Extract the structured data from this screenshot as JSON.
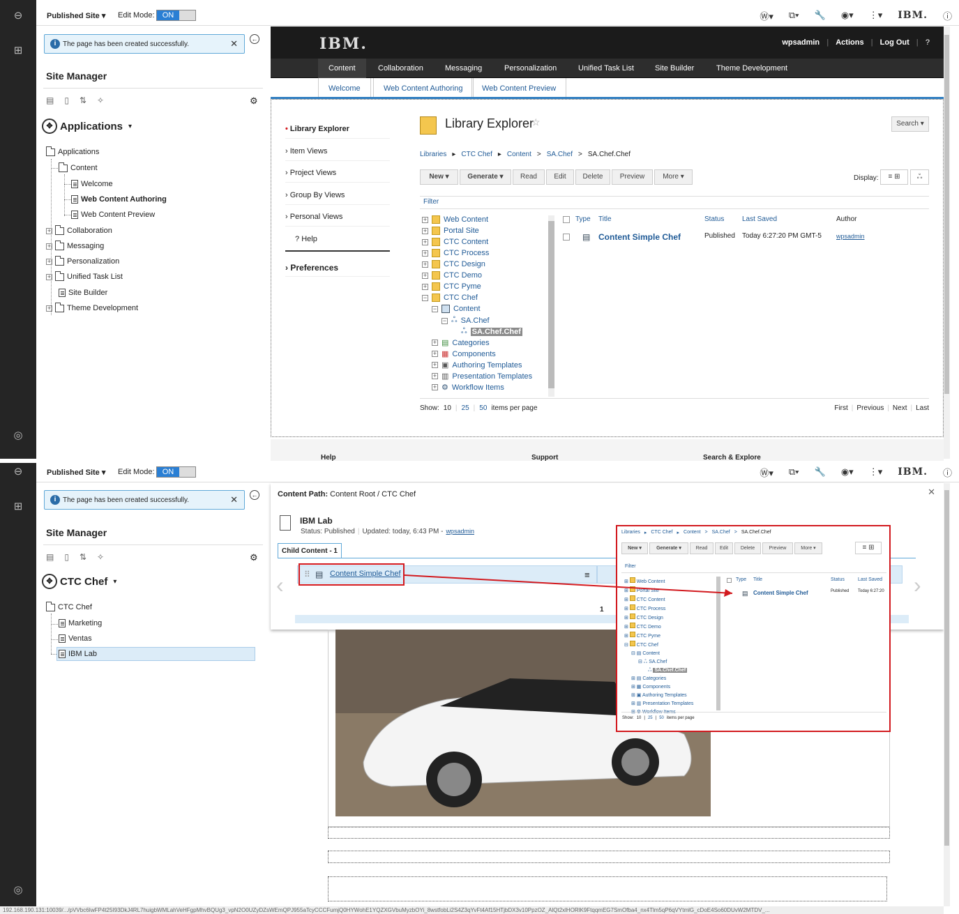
{
  "toolbar": {
    "published_site": "Published Site ▾",
    "edit_mode_label": "Edit Mode:",
    "edit_mode_value": "ON",
    "ibm_logo": "IBM."
  },
  "site_manager": {
    "alert": "The page has been created successfully.",
    "title": "Site Manager",
    "panel1": {
      "heading": "Applications",
      "tree": [
        "Applications",
        "Content",
        "Welcome",
        "Web Content Authoring",
        "Web Content Preview",
        "Collaboration",
        "Messaging",
        "Personalization",
        "Unified Task List",
        "Site Builder",
        "Theme Development"
      ]
    },
    "panel2": {
      "heading": "CTC Chef",
      "tree": [
        "CTC Chef",
        "Marketing",
        "Ventas",
        "IBM Lab"
      ]
    }
  },
  "portal": {
    "user": "wpsadmin",
    "actions": "Actions",
    "logout": "Log Out",
    "nav": [
      "Content",
      "Collaboration",
      "Messaging",
      "Personalization",
      "Unified Task List",
      "Site Builder",
      "Theme Development"
    ],
    "subnav": [
      "Welcome",
      "Web Content Authoring",
      "Web Content Preview"
    ],
    "left_nav": [
      "Library Explorer",
      "Item Views",
      "Project Views",
      "Group By Views",
      "Personal Views",
      "Help"
    ],
    "preferences": "Preferences",
    "library_title": "Library Explorer",
    "search": "Search ▾",
    "breadcrumb": [
      "Libraries",
      "CTC Chef",
      "Content",
      ">",
      "SA.Chef",
      ">",
      "SA.Chef.Chef"
    ],
    "buttons": [
      "New ▾",
      "Generate ▾",
      "Read",
      "Edit",
      "Delete",
      "Preview",
      "More ▾"
    ],
    "display": "Display:",
    "filter": "Filter",
    "tree": [
      "Web Content",
      "Portal Site",
      "CTC Content",
      "CTC Process",
      "CTC Design",
      "CTC Demo",
      "CTC Pyme",
      "CTC Chef",
      "Content",
      "SA.Chef",
      "SA.Chef.Chef",
      "Categories",
      "Components",
      "Authoring Templates",
      "Presentation Templates",
      "Workflow Items"
    ],
    "table_headers": [
      "Type",
      "Title",
      "Status",
      "Last Saved",
      "Author"
    ],
    "row": {
      "title": "Content Simple Chef",
      "status": "Published",
      "saved": "Today 6:27:20 PM GMT-5",
      "author": "wpsadmin"
    },
    "show": "Show:",
    "pages": [
      "10",
      "25",
      "50"
    ],
    "items_per_page": "items per page",
    "paging": [
      "First",
      "Previous",
      "Next",
      "Last"
    ],
    "footer": [
      "Help",
      "Support",
      "Search & Explore"
    ]
  },
  "overlay": {
    "content_path_label": "Content Path:",
    "content_path": "Content Root / CTC Chef",
    "page_title": "IBM Lab",
    "status": "Status: Published",
    "updated": "Updated: today, 6:43 PM -",
    "updated_user": "wpsadmin",
    "tab": "Child Content - 1",
    "item": "Content Simple Chef",
    "count": "1"
  },
  "zoom": {
    "saved": "Today 6:27:20"
  },
  "status_url": "192.168.190.131:10039/.../pVVbc6IwFP4t25I93DkJ4RL7huigbWMLahVeHFgpMhvBQUg3_vpN2O0UZyDZsWEmQPJ955aTcyCCCFumjQ0HYWohE1YQZXGVbuMyzbOYi_8wstfobLi2S4Z3qYvFt4Af15HTjbDX3v10PpzOZ_AlQt2xlHORlK9FtqqmEG7SmOfba4_nx4Tlm5qP6qVYtmlG_cDoE4So60DUvW2MTDV_..."
}
